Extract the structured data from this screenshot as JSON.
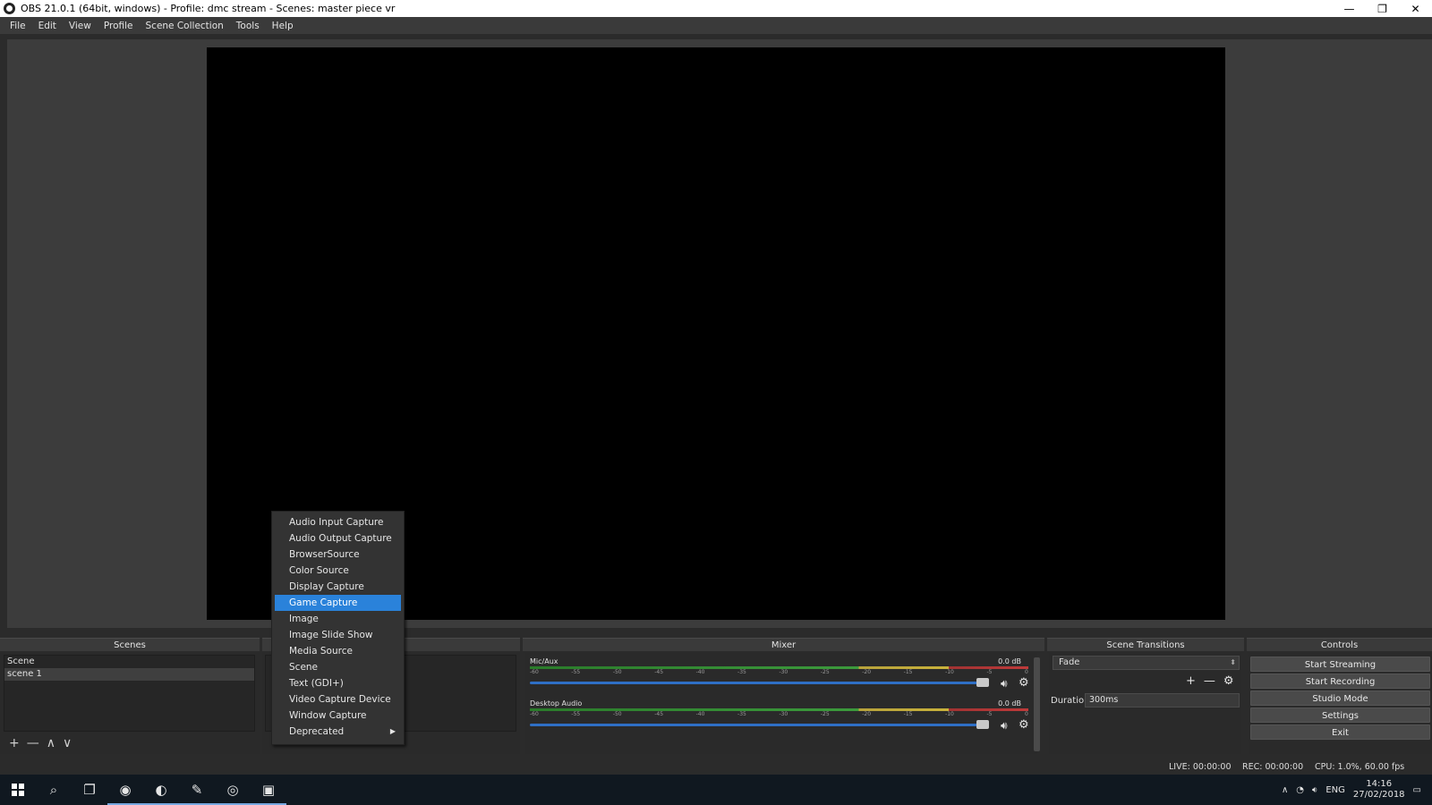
{
  "window": {
    "title": "OBS 21.0.1 (64bit, windows) - Profile: dmc stream - Scenes: master piece vr",
    "minimize": "—",
    "restore": "❐",
    "close": "✕"
  },
  "menu": [
    "File",
    "Edit",
    "View",
    "Profile",
    "Scene Collection",
    "Tools",
    "Help"
  ],
  "docks": {
    "scenes": "Scenes",
    "mixer": "Mixer",
    "transitions": "Scene Transitions",
    "controls": "Controls"
  },
  "scenes": {
    "items": [
      "Scene",
      "scene 1"
    ],
    "selected_index": 1,
    "toolbar": {
      "add": "+",
      "remove": "—",
      "up": "∧",
      "down": "∨"
    }
  },
  "mixer": {
    "tracks": [
      {
        "name": "Mic/Aux",
        "db": "0.0 dB"
      },
      {
        "name": "Desktop Audio",
        "db": "0.0 dB"
      }
    ],
    "ticks": [
      "-60",
      "-55",
      "-50",
      "-45",
      "-40",
      "-35",
      "-30",
      "-25",
      "-20",
      "-15",
      "-10",
      "-5",
      "0"
    ],
    "volume_level": 0.92,
    "speaker_icon": "speaker-icon",
    "gear_icon": "gear-icon"
  },
  "transitions": {
    "selected": "Fade",
    "duration_label": "Duration",
    "duration_value": "300ms",
    "tools": {
      "add": "+",
      "remove": "—",
      "settings": "⚙"
    }
  },
  "controls": {
    "start_streaming": "Start Streaming",
    "start_recording": "Start Recording",
    "studio_mode": "Studio Mode",
    "settings": "Settings",
    "exit": "Exit"
  },
  "status": {
    "live": "LIVE: 00:00:00",
    "rec": "REC: 00:00:00",
    "cpu": "CPU: 1.0%, 60.00 fps"
  },
  "context_menu": {
    "items": [
      "Audio Input Capture",
      "Audio Output Capture",
      "BrowserSource",
      "Color Source",
      "Display Capture",
      "Game Capture",
      "Image",
      "Image Slide Show",
      "Media Source",
      "Scene",
      "Text (GDI+)",
      "Video Capture Device",
      "Window Capture",
      "Deprecated"
    ],
    "highlighted_index": 5,
    "submenu_arrow": "▶"
  },
  "taskbar": {
    "language": "ENG",
    "time": "14:16",
    "date": "27/02/2018"
  },
  "colors": {
    "accent": "#2a82da",
    "slider": "#2f6fc5",
    "background": "#2b2b2b"
  }
}
